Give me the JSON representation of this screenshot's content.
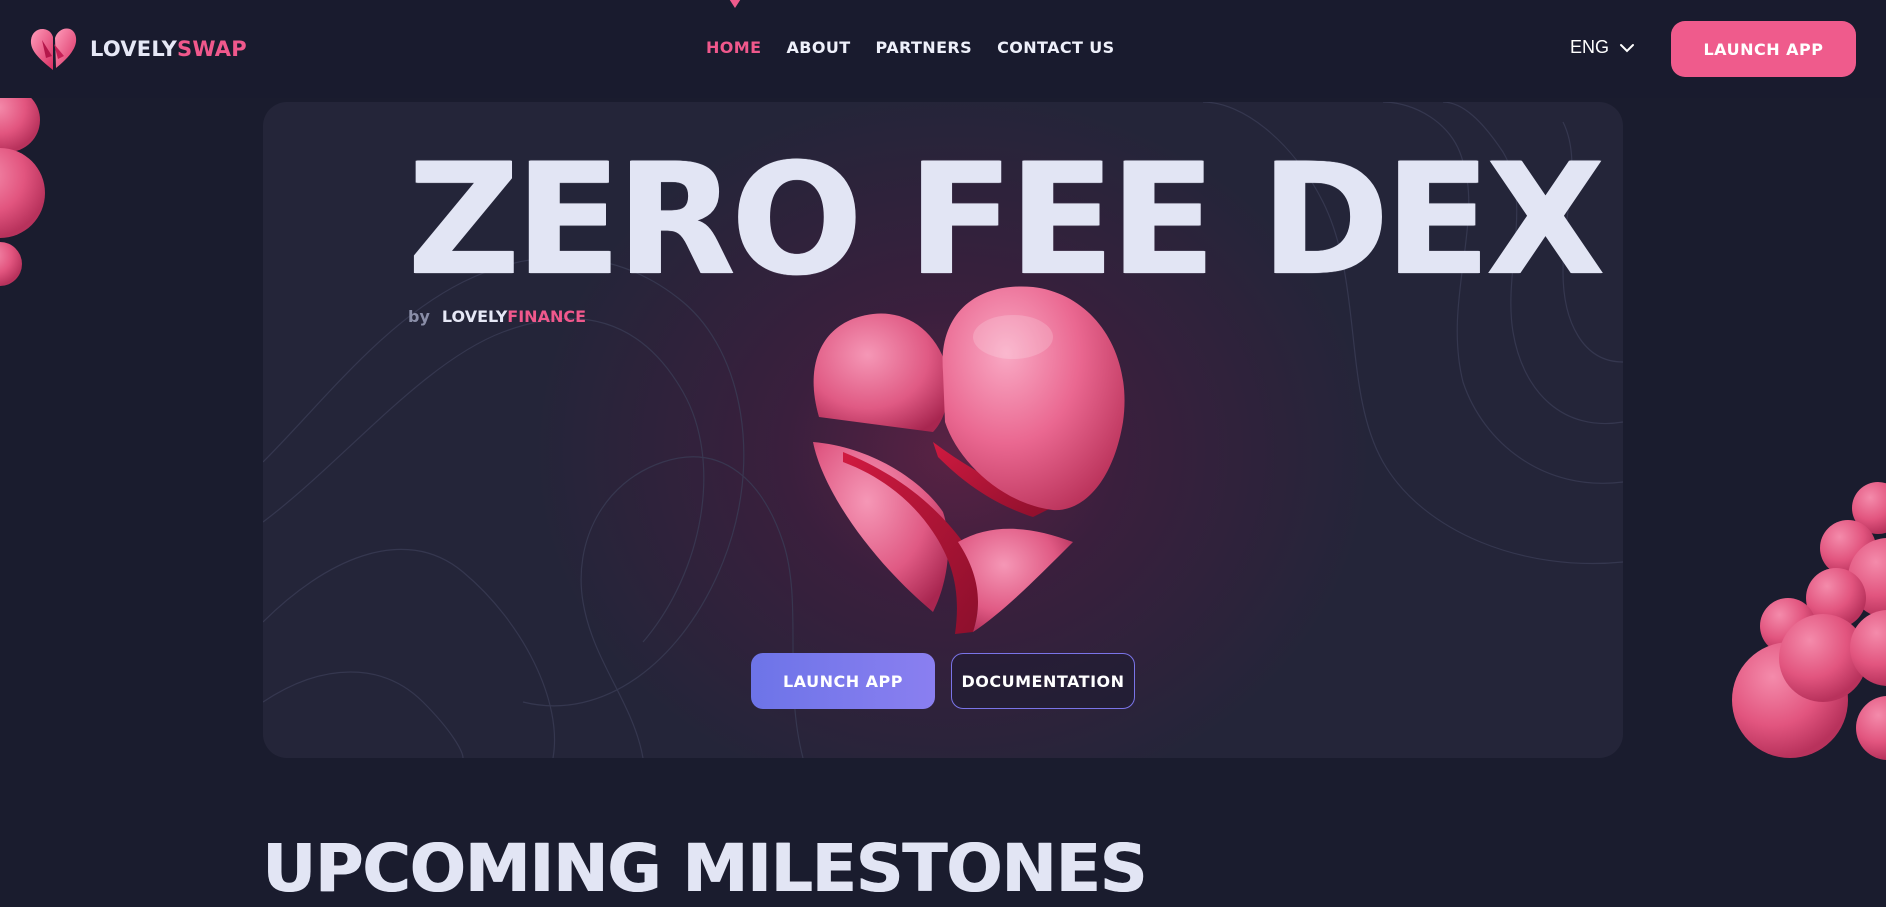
{
  "header": {
    "logo": {
      "text_primary": "LOVELY",
      "text_accent": "SWAP",
      "icon": "heart-logo-icon"
    },
    "nav": [
      {
        "label": "HOME",
        "active": true
      },
      {
        "label": "ABOUT",
        "active": false
      },
      {
        "label": "PARTNERS",
        "active": false
      },
      {
        "label": "CONTACT US",
        "active": false
      }
    ],
    "language": {
      "value": "ENG",
      "icon": "chevron-down-icon"
    },
    "launch_button": "LAUNCH APP"
  },
  "hero": {
    "title": "ZERO FEE DEX",
    "byline": {
      "prefix": "by",
      "brand_primary": "LOVELY",
      "brand_accent": "FINANCE"
    },
    "image": "3d-heart",
    "launch_button": "LAUNCH APP",
    "docs_button": "DOCUMENTATION"
  },
  "milestones": {
    "title": "UPCOMING MILESTONES"
  },
  "colors": {
    "background": "#1a1c2e",
    "accent_pink": "#ef5b8c",
    "accent_purple": "#7a74e8",
    "text": "#e2e5f4"
  }
}
